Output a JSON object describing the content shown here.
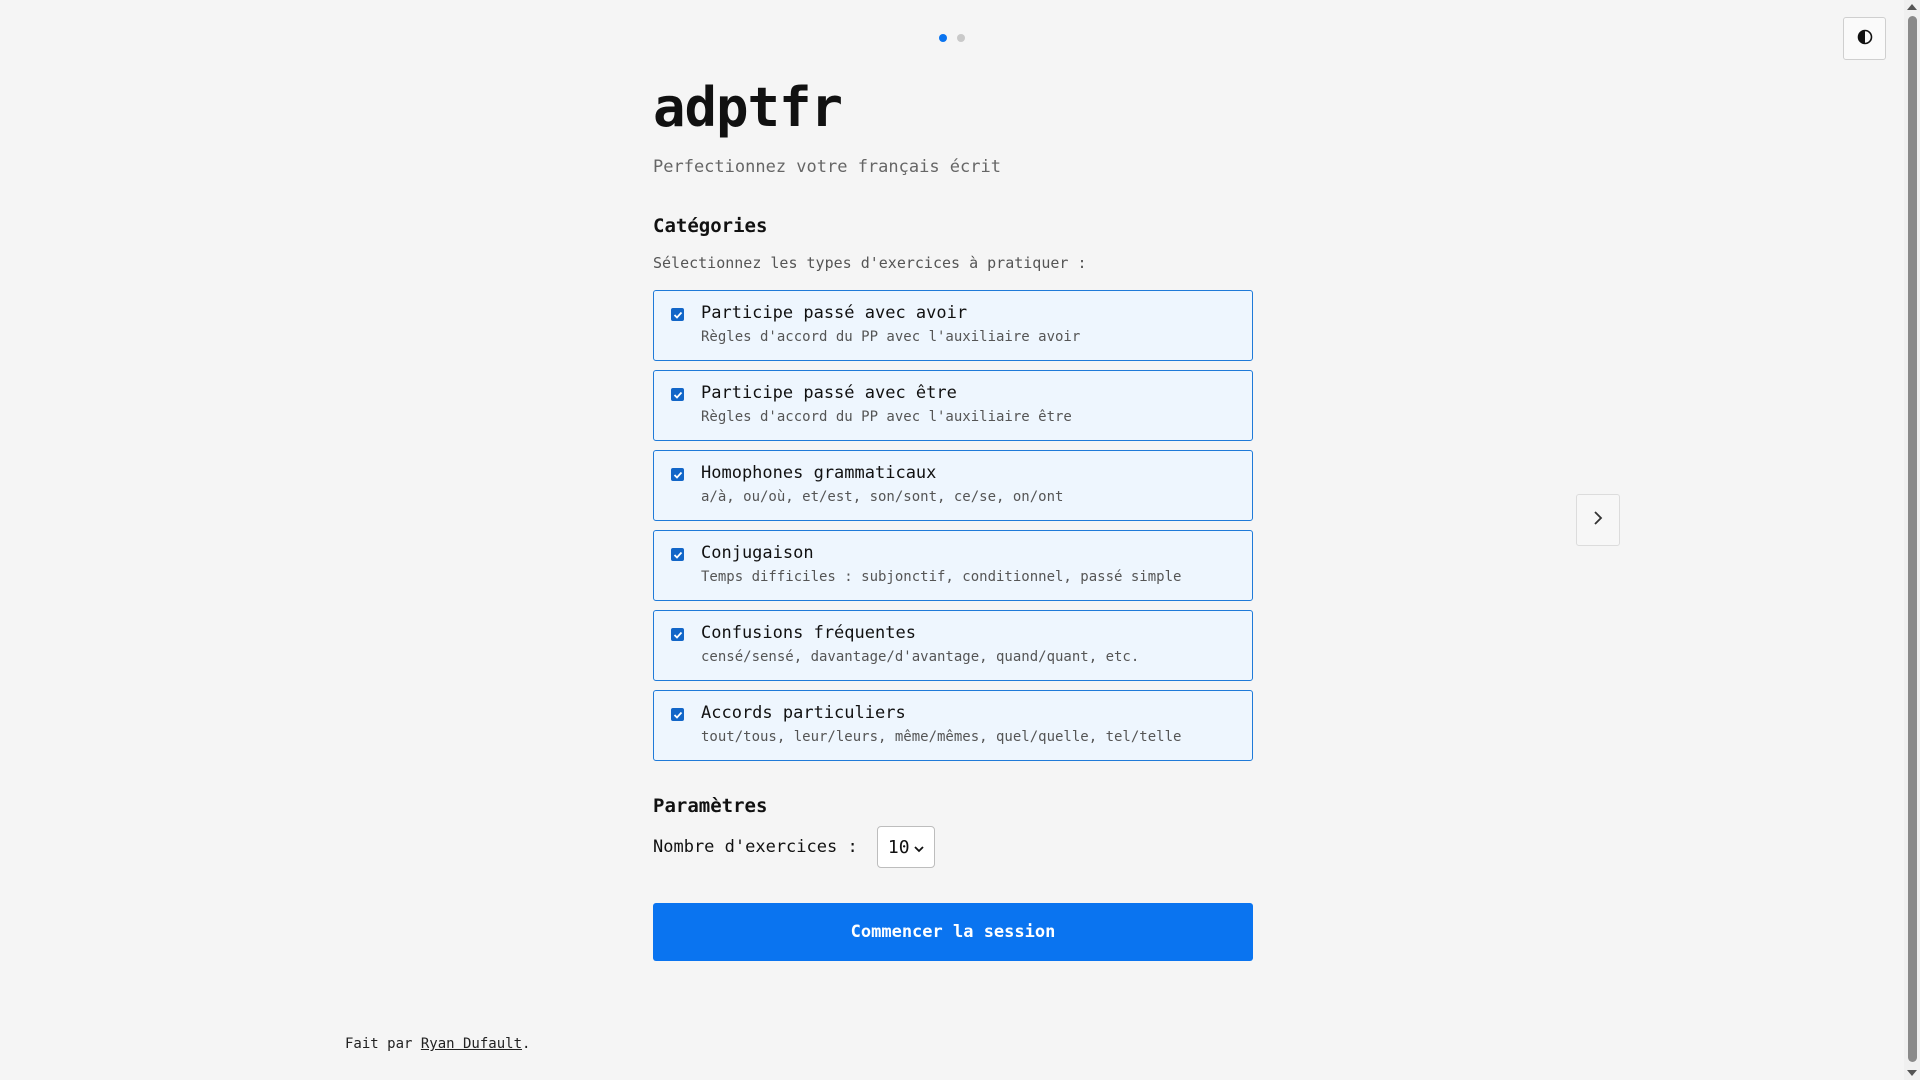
{
  "app": {
    "title": "adptfr",
    "subtitle": "Perfectionnez votre français écrit"
  },
  "pager": {
    "total": 2,
    "active": 1
  },
  "categories": {
    "heading": "Catégories",
    "hint": "Sélectionnez les types d'exercices à pratiquer :",
    "items": [
      {
        "label": "Participe passé avec avoir",
        "desc": "Règles d'accord du PP avec l'auxiliaire avoir",
        "checked": true
      },
      {
        "label": "Participe passé avec être",
        "desc": "Règles d'accord du PP avec l'auxiliaire être",
        "checked": true
      },
      {
        "label": "Homophones grammaticaux",
        "desc": "a/à, ou/où, et/est, son/sont, ce/se, on/ont",
        "checked": true
      },
      {
        "label": "Conjugaison",
        "desc": "Temps difficiles : subjonctif, conditionnel, passé simple",
        "checked": true
      },
      {
        "label": "Confusions fréquentes",
        "desc": "censé/sensé, davantage/d'avantage, quand/quant, etc.",
        "checked": true
      },
      {
        "label": "Accords particuliers",
        "desc": "tout/tous, leur/leurs, même/mêmes, quel/quelle, tel/telle",
        "checked": true
      }
    ]
  },
  "params": {
    "heading": "Paramètres",
    "count_label": "Nombre d'exercices :",
    "count_value": "10"
  },
  "actions": {
    "start_label": "Commencer la session"
  },
  "footer": {
    "prefix": "Fait par ",
    "author": "Ryan Dufault",
    "suffix": "."
  },
  "colors": {
    "accent": "#0a74f0",
    "card_border": "#1f7ad8",
    "card_bg": "#eef6fe"
  },
  "icons": {
    "theme": "contrast-icon",
    "next": "chevron-right-icon",
    "select": "chevron-down-icon",
    "checkbox": "checkmark-icon"
  }
}
